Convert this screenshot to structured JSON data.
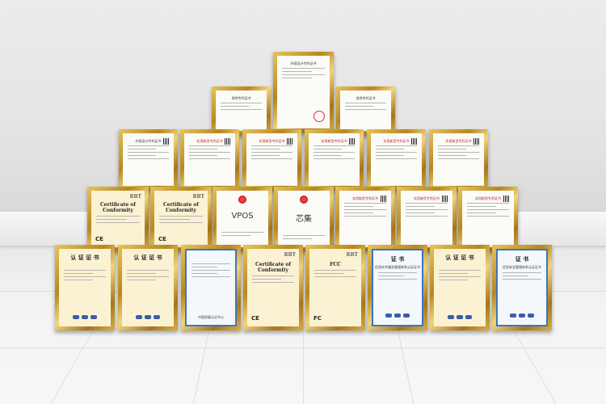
{
  "scene": {
    "description_label": "",
    "top_row": [
      {
        "header": "外观设计专利证书",
        "style": "patent"
      }
    ],
    "row2": [
      {
        "header": "发明专利证书",
        "style": "patent"
      },
      {
        "header": "发明专利证书",
        "style": "patent"
      }
    ],
    "row3": [
      {
        "header": "外观设计专利证书",
        "style": "patent"
      },
      {
        "header": "实用新型专利证书",
        "style": "patent"
      },
      {
        "header": "实用新型专利证书",
        "style": "patent"
      },
      {
        "header": "实用新型专利证书",
        "style": "patent"
      },
      {
        "header": "实用新型专利证书",
        "style": "patent"
      },
      {
        "header": "实用新型专利证书",
        "style": "patent"
      }
    ],
    "row4": [
      {
        "rbt": "RBT",
        "title": "Certificate of Conformity",
        "mark": "CE"
      },
      {
        "rbt": "RBT",
        "title": "Certificate of Conformity",
        "mark": "CE"
      },
      {
        "title": "VPOS",
        "style": "trademark"
      },
      {
        "title": "芯集",
        "style": "trademark"
      },
      {
        "header": "实用新型专利证书",
        "style": "patent"
      },
      {
        "header": "实用新型专利证书",
        "style": "patent"
      },
      {
        "header": "实用新型专利证书",
        "style": "patent"
      }
    ],
    "row5": [
      {
        "title": "认 证 证 书",
        "style": "cream"
      },
      {
        "title": "认 证 证 书",
        "style": "cream"
      },
      {
        "title": "",
        "style": "blue-ccc",
        "footer": "中国质量认证中心"
      },
      {
        "rbt": "RBT",
        "title": "Certificate of Conformity",
        "mark": "CE"
      },
      {
        "rbt": "RBT",
        "title": "FCC",
        "mark": "FC"
      },
      {
        "title": "证 书",
        "subtitle": "信息技术服务管理体系认证证书",
        "style": "blue"
      },
      {
        "title": "认 证 证 书",
        "style": "cream"
      },
      {
        "title": "证 书",
        "subtitle": "信息安全管理体系认证证书",
        "style": "blue"
      }
    ]
  }
}
